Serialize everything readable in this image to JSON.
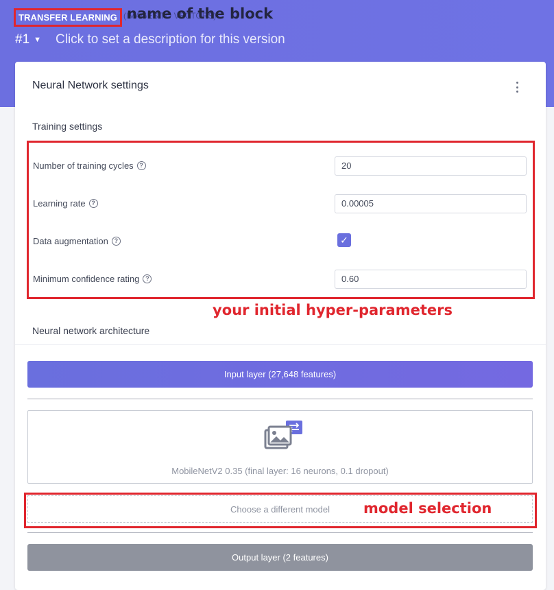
{
  "header": {
    "block_name": "TRANSFER LEARNING",
    "block_subtitle": "(IMAGES TO VECTORS)",
    "version": "#1",
    "version_description": "Click to set a description for this version"
  },
  "annotations": {
    "block": "name of the block",
    "hyperparams": "your initial hyper-parameters",
    "model": "model selection"
  },
  "card": {
    "title": "Neural Network settings",
    "training_title": "Training settings",
    "fields": {
      "cycles_label": "Number of training cycles",
      "cycles_value": "20",
      "lr_label": "Learning rate",
      "lr_value": "0.00005",
      "aug_label": "Data augmentation",
      "aug_checked": true,
      "conf_label": "Minimum confidence rating",
      "conf_value": "0.60"
    },
    "architecture_title": "Neural network architecture",
    "input_layer": "Input layer (27,648 features)",
    "model_caption": "MobileNetV2 0.35 (final layer: 16 neurons, 0.1 dropout)",
    "choose_model": "Choose a different model",
    "output_layer": "Output layer (2 features)"
  },
  "colors": {
    "accent": "#6c6fe0",
    "annotation_red": "#e0262e"
  }
}
